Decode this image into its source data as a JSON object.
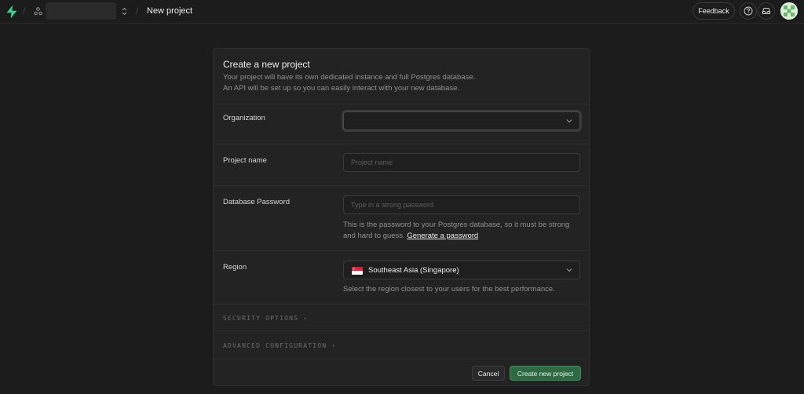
{
  "topbar": {
    "page_title": "New project",
    "feedback_label": "Feedback"
  },
  "card": {
    "title": "Create a new project",
    "description_line1": "Your project will have its own dedicated instance and full Postgres database.",
    "description_line2": "An API will be set up so you can easily interact with your new database."
  },
  "organization": {
    "label": "Organization",
    "value": ""
  },
  "project_name": {
    "label": "Project name",
    "placeholder": "Project name"
  },
  "database_password": {
    "label": "Database Password",
    "placeholder": "Type in a strong password",
    "help_text": "This is the password to your Postgres database, so it must be strong and hard to guess.",
    "generate_link": "Generate a password"
  },
  "region": {
    "label": "Region",
    "value": "Southeast Asia (Singapore)",
    "flag_icon": "singapore-flag-icon",
    "help_text": "Select the region closest to your users for the best performance."
  },
  "sections": {
    "security_options": "SECURITY OPTIONS",
    "advanced_configuration": "ADVANCED CONFIGURATION"
  },
  "footer": {
    "cancel_label": "Cancel",
    "create_label": "Create new project"
  },
  "colors": {
    "background": "#1c1c1c",
    "card": "#232323",
    "brand": "#3ecf8e",
    "primary_button": "#2d6a43"
  }
}
